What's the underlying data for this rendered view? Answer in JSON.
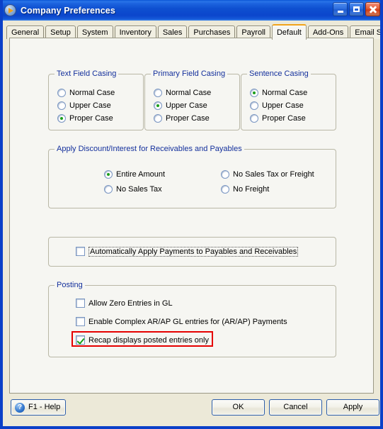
{
  "window": {
    "title": "Company Preferences",
    "icon": "play-circle-icon",
    "accent_blue": "#0b40c8",
    "legend_blue": "#14309c",
    "highlight_red": "#e50000",
    "active_tab_accent": "#f0a21a",
    "buttons": {
      "minimize": "minimize-icon",
      "maximize": "maximize-icon",
      "close": "close-icon"
    }
  },
  "tabs": [
    {
      "label": "General",
      "active": false
    },
    {
      "label": "Setup",
      "active": false
    },
    {
      "label": "System",
      "active": false
    },
    {
      "label": "Inventory",
      "active": false
    },
    {
      "label": "Sales",
      "active": false
    },
    {
      "label": "Purchases",
      "active": false
    },
    {
      "label": "Payroll",
      "active": false
    },
    {
      "label": "Default",
      "active": true
    },
    {
      "label": "Add-Ons",
      "active": false
    },
    {
      "label": "Email Setup",
      "active": false
    }
  ],
  "groups": {
    "text_field_casing": {
      "legend": "Text Field Casing",
      "options": [
        {
          "label": "Normal Case",
          "selected": false
        },
        {
          "label": "Upper Case",
          "selected": false
        },
        {
          "label": "Proper Case",
          "selected": true
        }
      ]
    },
    "primary_field_casing": {
      "legend": "Primary Field Casing",
      "options": [
        {
          "label": "Normal Case",
          "selected": false
        },
        {
          "label": "Upper Case",
          "selected": true
        },
        {
          "label": "Proper Case",
          "selected": false
        }
      ]
    },
    "sentence_casing": {
      "legend": "Sentence Casing",
      "options": [
        {
          "label": "Normal Case",
          "selected": true
        },
        {
          "label": "Upper Case",
          "selected": false
        },
        {
          "label": "Proper Case",
          "selected": false
        }
      ]
    },
    "apply_discount": {
      "legend": "Apply Discount/Interest for Receivables and Payables",
      "options_left": [
        {
          "label": "Entire Amount",
          "selected": true
        },
        {
          "label": "No Sales Tax",
          "selected": false
        }
      ],
      "options_right": [
        {
          "label": "No Sales Tax or Freight",
          "selected": false
        },
        {
          "label": "No Freight",
          "selected": false
        }
      ]
    },
    "auto_apply": {
      "legend": "",
      "checkbox": {
        "label": "Automatically Apply Payments to Payables and Receivables",
        "checked": false,
        "focused": true
      }
    },
    "posting": {
      "legend": "Posting",
      "checkboxes": [
        {
          "label": "Allow Zero Entries in GL",
          "checked": false,
          "highlighted": false
        },
        {
          "label": "Enable Complex AR/AP  GL entries for (AR/AP)  Payments",
          "checked": false,
          "highlighted": false
        },
        {
          "label": "Recap displays posted entries only",
          "checked": true,
          "highlighted": true
        }
      ]
    }
  },
  "footer": {
    "help": {
      "label": "F1 - Help",
      "icon": "question-mark-icon"
    },
    "ok": "OK",
    "cancel": "Cancel",
    "apply": "Apply"
  }
}
